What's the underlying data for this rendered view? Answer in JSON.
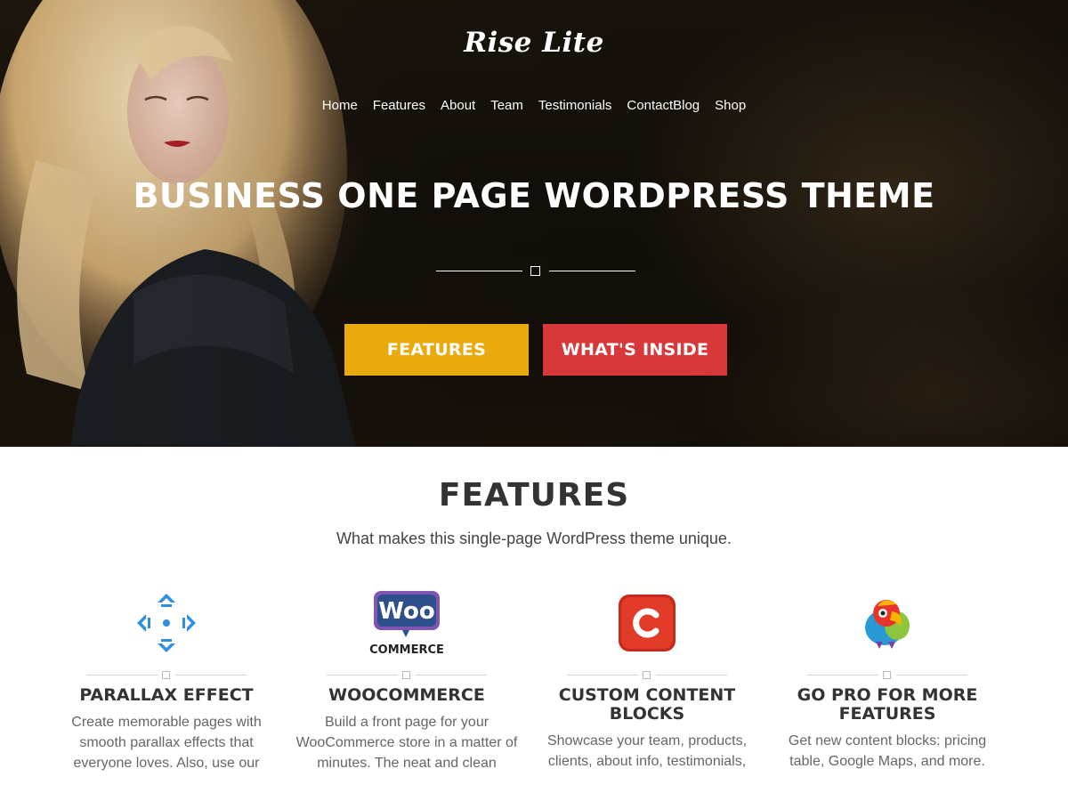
{
  "site": {
    "logo": "Rise Lite"
  },
  "nav": {
    "items": [
      {
        "label": "Home"
      },
      {
        "label": "Features"
      },
      {
        "label": "About"
      },
      {
        "label": "Team"
      },
      {
        "label": "Testimonials"
      },
      {
        "label": "Contact"
      },
      {
        "label": "Blog"
      },
      {
        "label": "Shop"
      }
    ]
  },
  "hero": {
    "title": "BUSINESS ONE PAGE WORDPRESS THEME",
    "buttons": [
      {
        "label": "FEATURES",
        "color": "#eaa90d"
      },
      {
        "label": "WHAT'S INSIDE",
        "color": "#d8383a"
      }
    ]
  },
  "features": {
    "title": "FEATURES",
    "subtitle": "What makes this single-page WordPress theme unique.",
    "items": [
      {
        "icon": "parallax-arrows-icon",
        "title": "PARALLAX EFFECT",
        "text": "Create memorable pages with smooth parallax effects that everyone loves. Also, use our"
      },
      {
        "icon": "woocommerce-logo-icon",
        "logo_top": "Woo",
        "logo_bottom": "COMMERCE",
        "title": "WOOCOMMERCE",
        "text": "Build a front page for your WooCommerce store in a matter of minutes. The neat and clean"
      },
      {
        "icon": "custom-content-c-icon",
        "title": "CUSTOM CONTENT BLOCKS",
        "text": "Showcase your team, products, clients, about info, testimonials,"
      },
      {
        "icon": "parrot-mascot-icon",
        "title": "GO PRO FOR MORE FEATURES",
        "text": "Get new content blocks: pricing table, Google Maps, and more."
      }
    ]
  },
  "colors": {
    "accent_yellow": "#eaa90d",
    "accent_red": "#d8383a",
    "icon_blue": "#2f8fe0",
    "woo_purple": "#7f54b3"
  }
}
